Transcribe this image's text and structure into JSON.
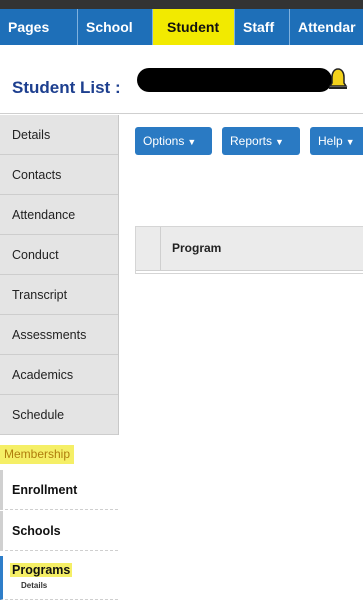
{
  "tabs": [
    "Pages",
    "School",
    "Student",
    "Staff",
    "Attendar"
  ],
  "header": {
    "title": "Student List :"
  },
  "sidebar": {
    "items": [
      "Details",
      "Contacts",
      "Attendance",
      "Conduct",
      "Transcript",
      "Assessments",
      "Academics",
      "Schedule"
    ],
    "section_label": "Membership",
    "subitems": [
      {
        "label": "Enrollment"
      },
      {
        "label": "Schools"
      },
      {
        "label": "Programs",
        "sub": "Details"
      }
    ]
  },
  "toolbar": {
    "options": "Options",
    "reports": "Reports",
    "help": "Help"
  },
  "table": {
    "columns": [
      "Program"
    ]
  },
  "colors": {
    "tab_bar": "#1e6fb8",
    "active_tab": "#f2ea00",
    "title": "#1d3f8f",
    "highlight": "#f5ef66",
    "button": "#2a7ac3"
  }
}
